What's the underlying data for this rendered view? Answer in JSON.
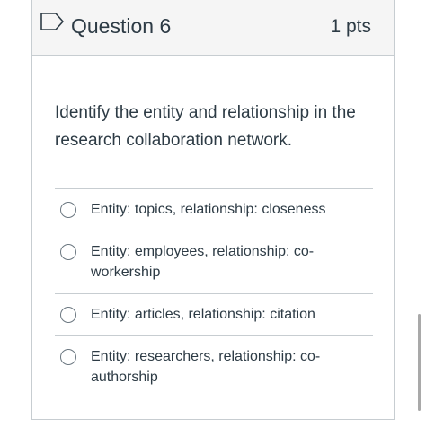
{
  "question": {
    "title": "Question 6",
    "points": "1 pts",
    "text": "Identify the entity and relationship in the research collaboration network.",
    "flag_icon": "bookmark-flag-icon"
  },
  "answers": [
    {
      "label": "Entity: topics, relationship: closeness"
    },
    {
      "label": "Entity: employees, relationship: co-workership"
    },
    {
      "label": "Entity: articles, relationship: citation"
    },
    {
      "label": "Entity: researchers, relationship: co-authorship"
    }
  ],
  "colors": {
    "text": "#2d3b45",
    "border": "#c7cdd1",
    "header_bg": "#f5f5f5"
  }
}
